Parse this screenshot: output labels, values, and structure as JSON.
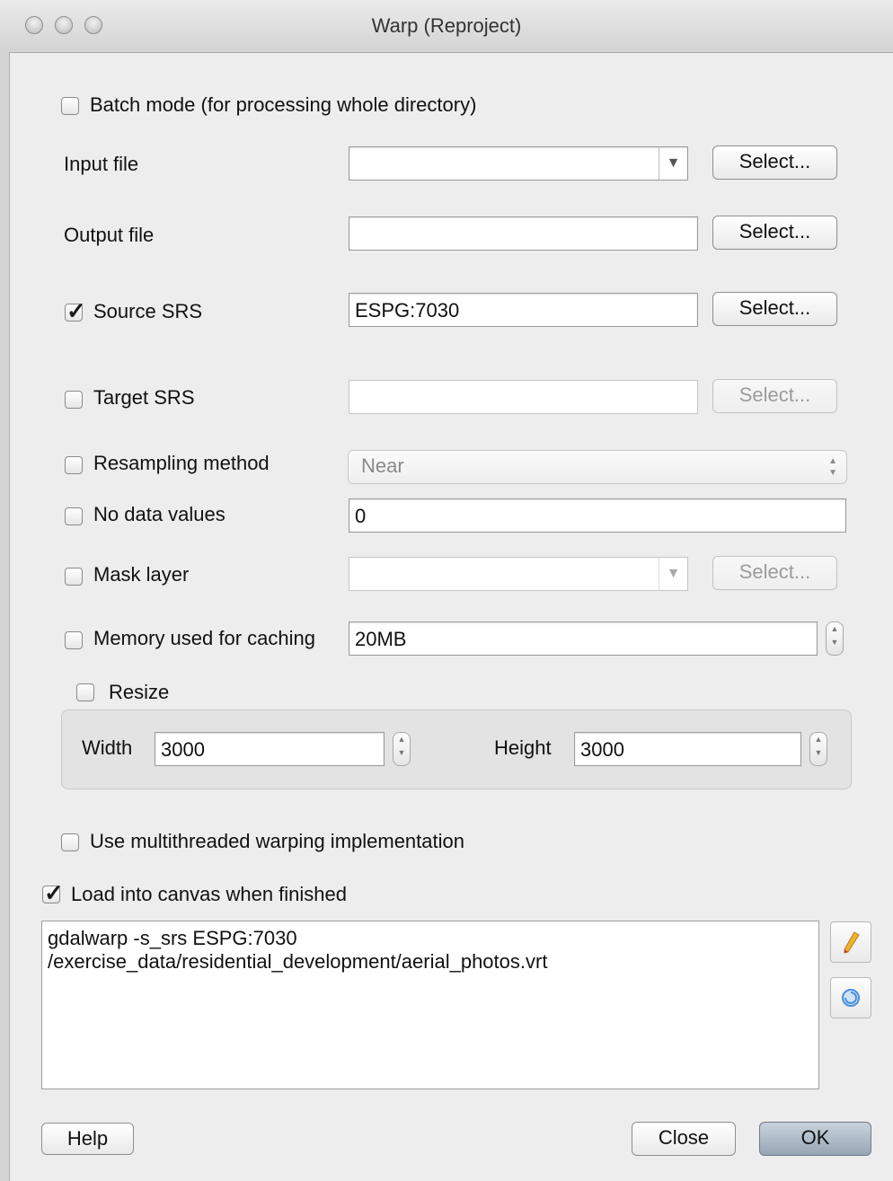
{
  "window": {
    "title": "Warp (Reproject)"
  },
  "batch_mode": {
    "label": "Batch mode (for processing whole directory)",
    "checked": false
  },
  "input_file": {
    "label": "Input file",
    "value": "",
    "select_label": "Select..."
  },
  "output_file": {
    "label": "Output file",
    "value": "",
    "select_label": "Select..."
  },
  "source_srs": {
    "label": "Source SRS",
    "checked": true,
    "value": "ESPG:7030",
    "select_label": "Select..."
  },
  "target_srs": {
    "label": "Target SRS",
    "checked": false,
    "value": "",
    "select_label": "Select..."
  },
  "resampling": {
    "label": "Resampling method",
    "checked": false,
    "value": "Near"
  },
  "no_data": {
    "label": "No data values",
    "checked": false,
    "value": "0"
  },
  "mask_layer": {
    "label": "Mask layer",
    "checked": false,
    "value": "",
    "select_label": "Select..."
  },
  "memory": {
    "label": "Memory used for caching",
    "checked": false,
    "value": "20MB"
  },
  "resize": {
    "label": "Resize",
    "checked": false,
    "width_label": "Width",
    "width_value": "3000",
    "height_label": "Height",
    "height_value": "3000"
  },
  "multithread": {
    "label": "Use multithreaded warping implementation",
    "checked": false
  },
  "load_canvas": {
    "label": "Load into canvas when finished",
    "checked": true
  },
  "command": {
    "line1": "gdalwarp -s_srs ESPG:7030",
    "line2": "/exercise_data/residential_development/aerial_photos.vrt"
  },
  "buttons": {
    "help": "Help",
    "close": "Close",
    "ok": "OK"
  },
  "icons": {
    "edit": "pencil-icon",
    "reset": "reset-icon"
  }
}
